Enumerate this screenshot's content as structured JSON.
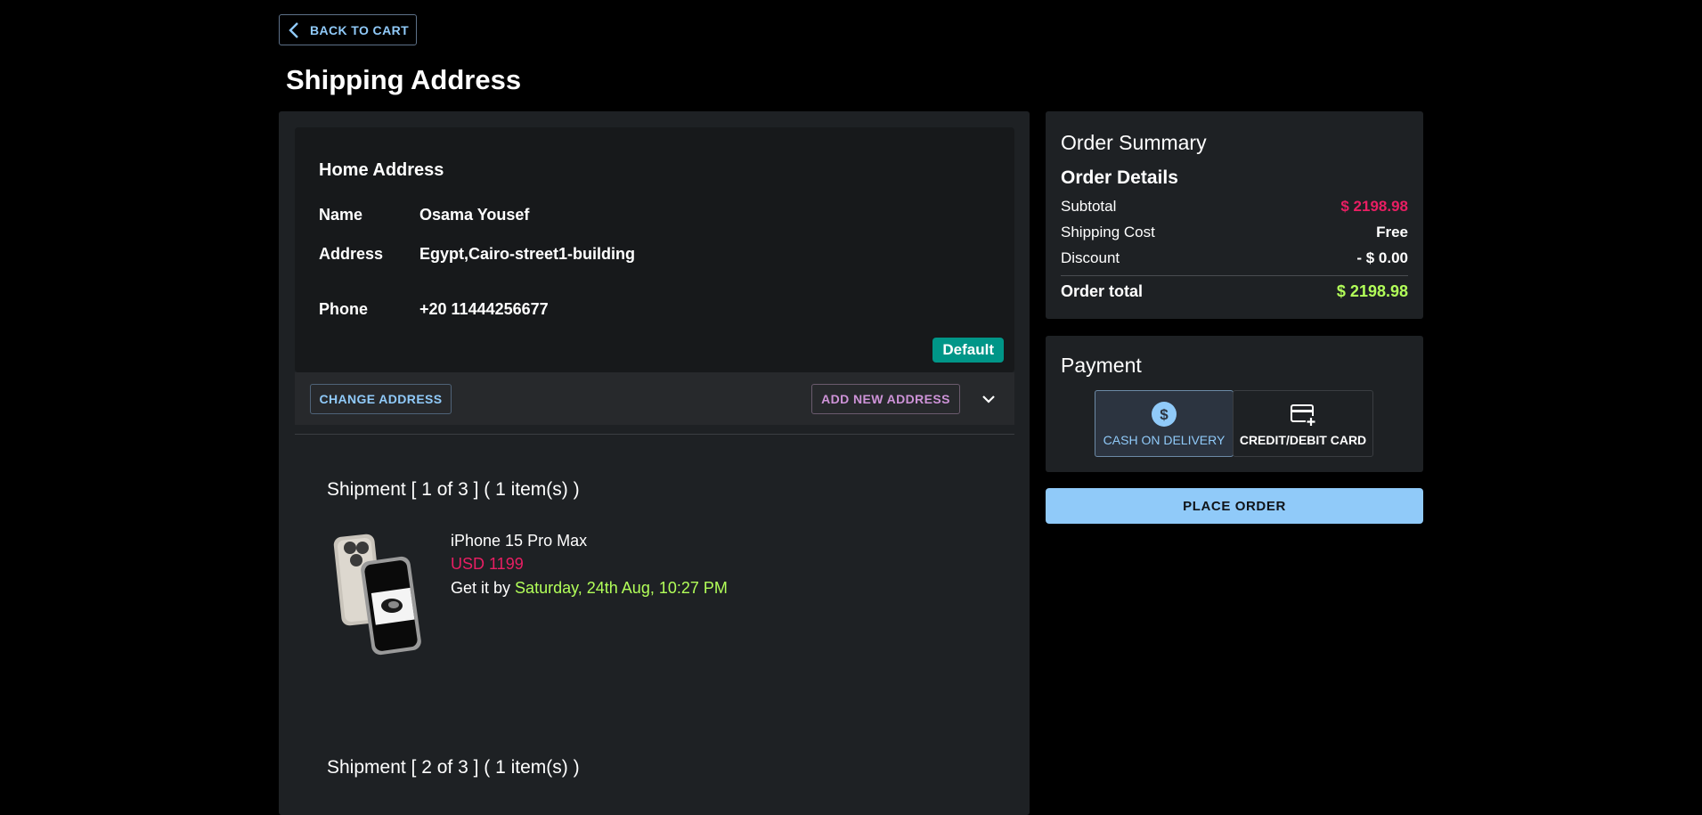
{
  "nav": {
    "back_label": "BACK TO CART"
  },
  "page": {
    "title": "Shipping Address"
  },
  "address": {
    "card_title": "Home Address",
    "name_label": "Name",
    "name_value": "Osama Yousef",
    "address_label": "Address",
    "address_value": "Egypt,Cairo-street1-building",
    "phone_label": "Phone",
    "phone_value": "+20 11444256677",
    "default_badge": "Default",
    "change_label": "CHANGE ADDRESS",
    "add_label": "ADD NEW ADDRESS"
  },
  "shipments": [
    {
      "title": "Shipment [ 1 of 3 ] ( 1 item(s) )",
      "product_name": "iPhone 15 Pro Max",
      "price": "USD 1199",
      "eta_prefix": "Get it by",
      "eta_date": "Saturday, 24th Aug, 10:27 PM"
    },
    {
      "title": "Shipment [ 2 of 3 ] ( 1 item(s) )"
    }
  ],
  "summary": {
    "title": "Order Summary",
    "details_title": "Order Details",
    "subtotal_label": "Subtotal",
    "subtotal_value": "$ 2198.98",
    "shipping_label": "Shipping Cost",
    "shipping_value": "Free",
    "discount_label": "Discount",
    "discount_value": "- $ 0.00",
    "total_label": "Order total",
    "total_value": "$ 2198.98"
  },
  "payment": {
    "title": "Payment",
    "options": [
      {
        "label": "CASH ON DELIVERY",
        "icon": "dollar-circle-icon",
        "selected": true
      },
      {
        "label": "CREDIT/DEBIT CARD",
        "icon": "credit-card-add-icon",
        "selected": false
      }
    ]
  },
  "actions": {
    "place_order_label": "PLACE ORDER"
  },
  "colors": {
    "accent_blue": "#90caf9",
    "accent_purple": "#ce93d8",
    "price_pink": "#e91e63",
    "total_green": "#b2ff59",
    "badge_teal": "#009688"
  }
}
